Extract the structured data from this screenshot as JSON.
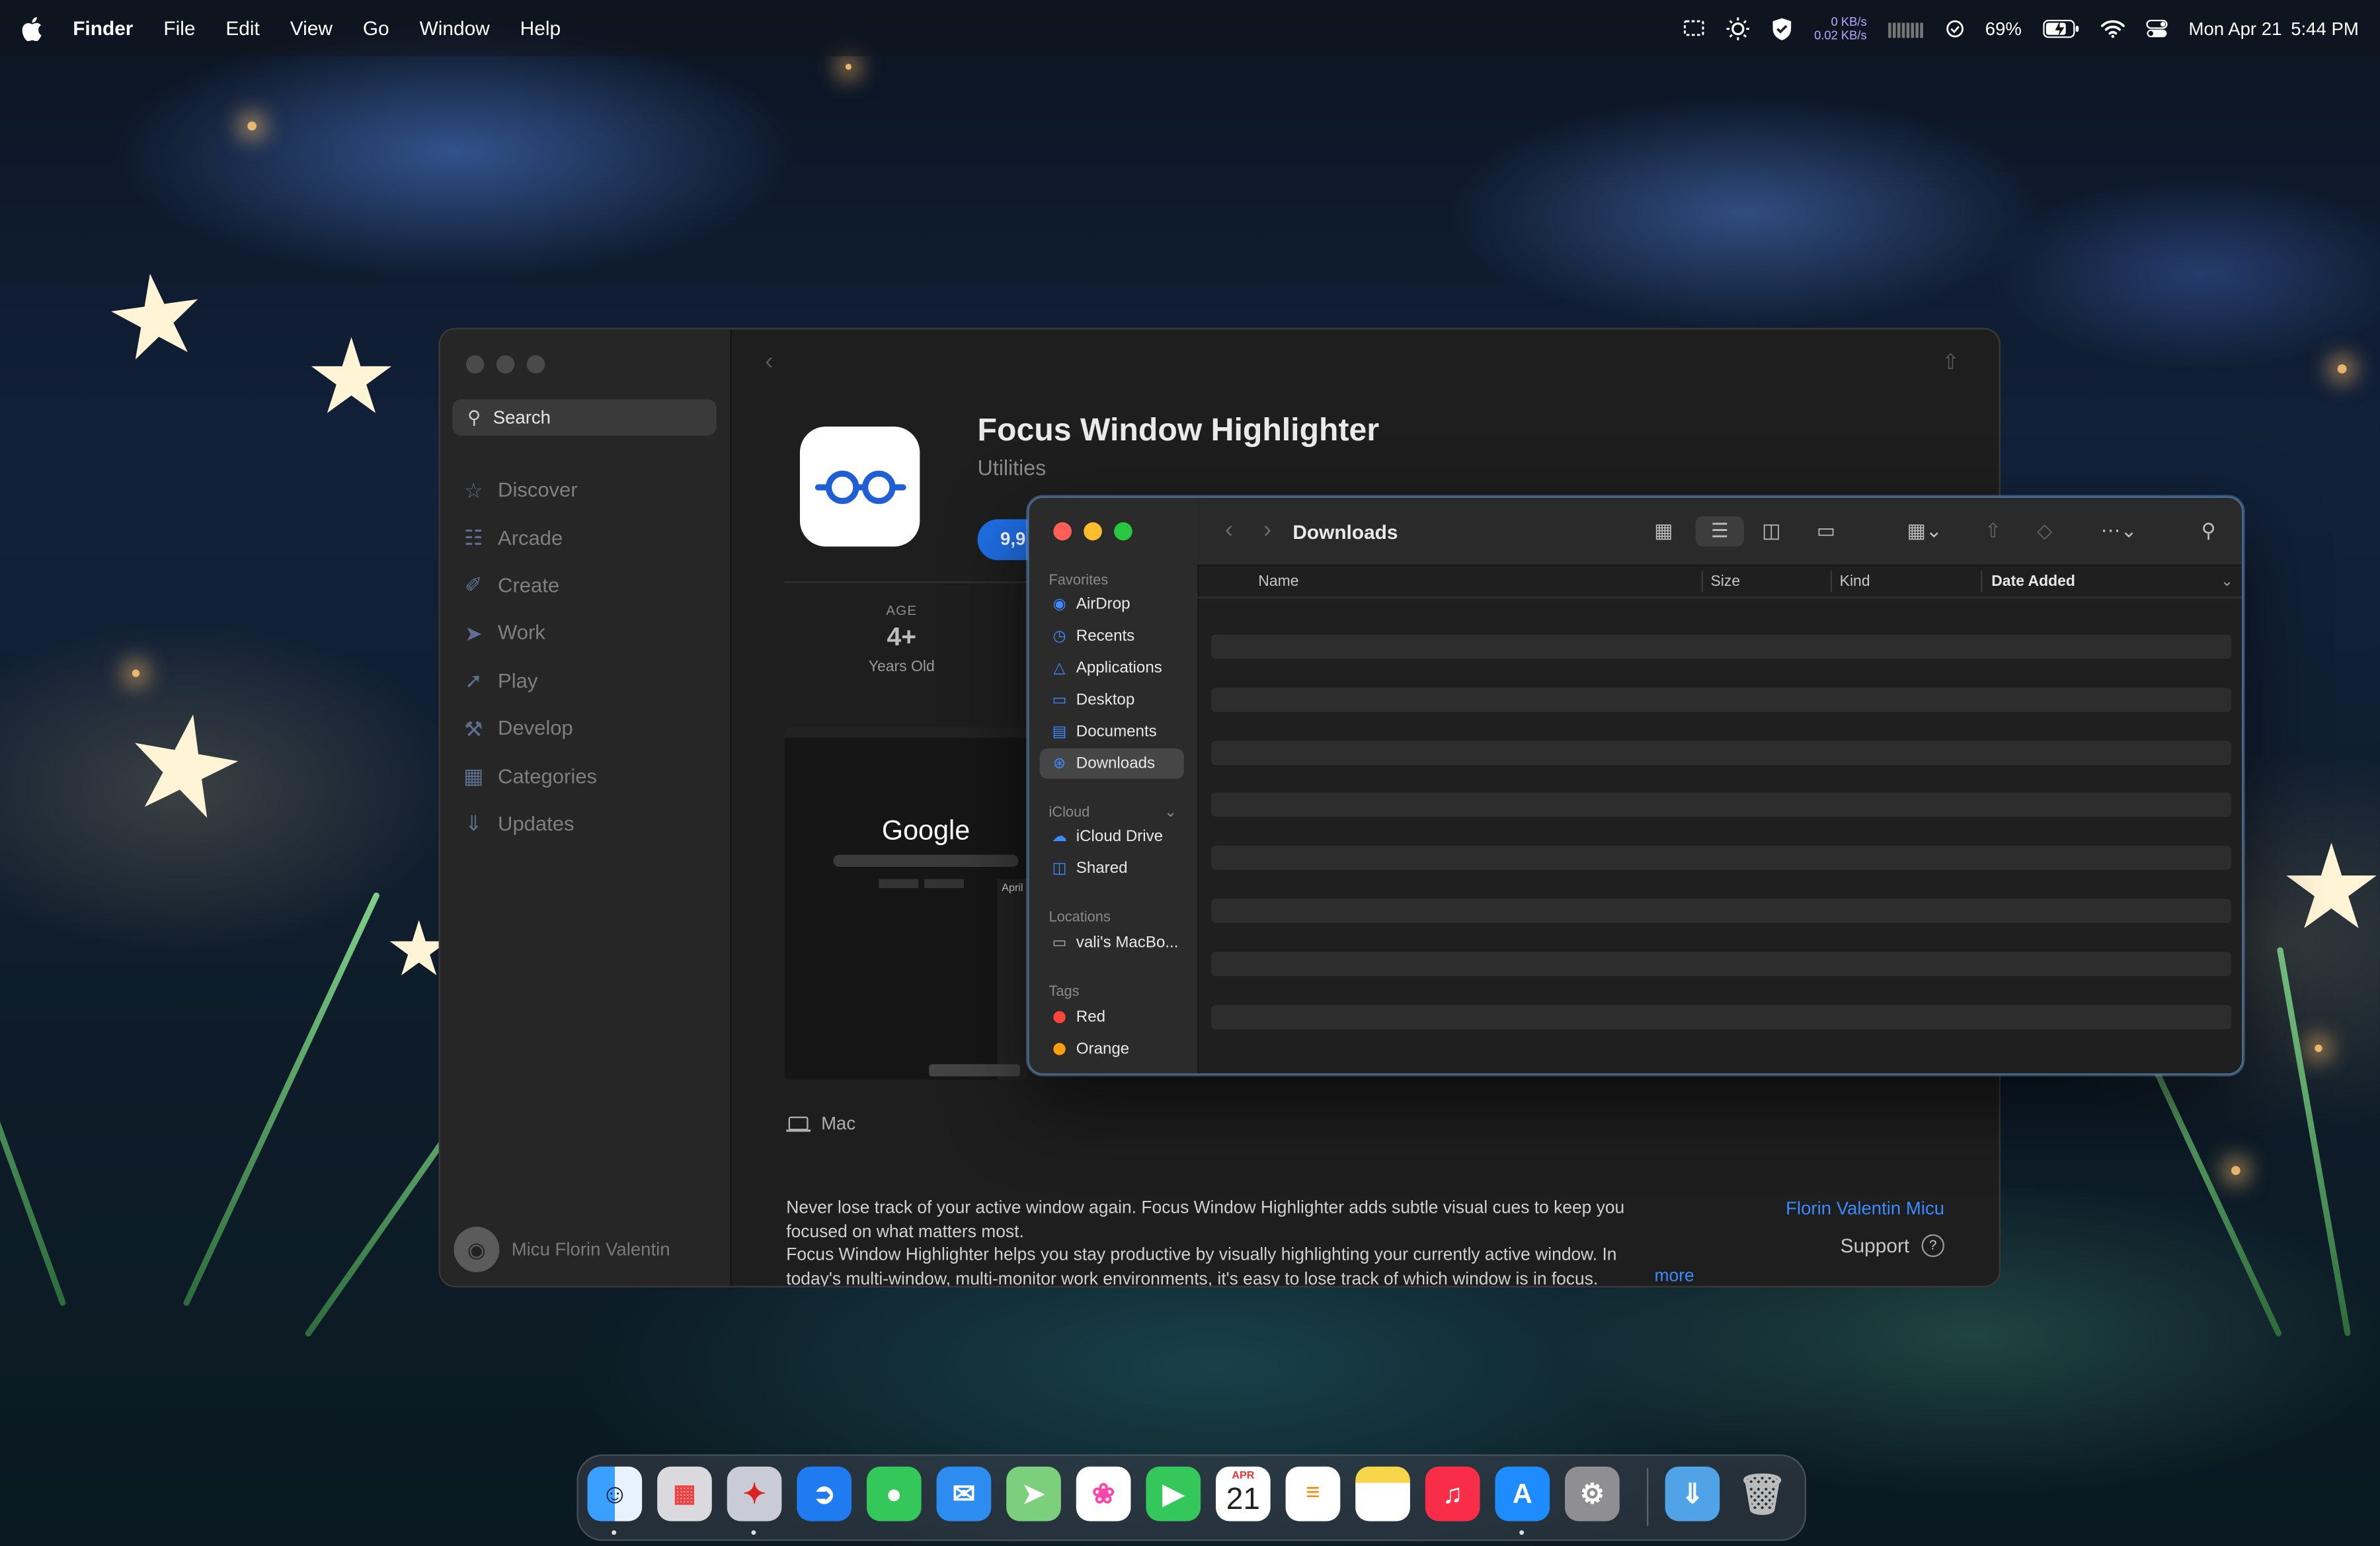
{
  "menubar": {
    "app": "Finder",
    "menus": [
      "File",
      "Edit",
      "View",
      "Go",
      "Window",
      "Help"
    ],
    "net_up": "0 KB/s",
    "net_down": "0.02 KB/s",
    "battery": "69%",
    "date": "Mon Apr 21",
    "time": "5:44 PM"
  },
  "appstore": {
    "search_placeholder": "Search",
    "nav": [
      "Discover",
      "Arcade",
      "Create",
      "Work",
      "Play",
      "Develop",
      "Categories",
      "Updates"
    ],
    "user": "Micu Florin Valentin",
    "app_title": "Focus Window Highlighter",
    "app_category": "Utilities",
    "price_partial": "9,9",
    "age_label": "AGE",
    "age_value": "4+",
    "age_sub": "Years Old",
    "screenshot_google": "Google",
    "screenshot_april": "April",
    "platform": "Mac",
    "description": "Never lose track of your active window again. Focus Window Highlighter adds subtle visual cues to keep you focused on what matters most.\nFocus Window Highlighter helps you stay productive by visually highlighting your currently active window. In today's multi-window, multi-monitor work environments, it's easy to lose track of which window is in focus.",
    "more": "more",
    "developer": "Florin Valentin Micu",
    "support": "Support"
  },
  "finder": {
    "title": "Downloads",
    "sections": {
      "favorites": "Favorites",
      "icloud": "iCloud",
      "locations": "Locations",
      "tags": "Tags"
    },
    "favorites": [
      "AirDrop",
      "Recents",
      "Applications",
      "Desktop",
      "Documents",
      "Downloads"
    ],
    "icloud_items": [
      "iCloud Drive",
      "Shared"
    ],
    "locations": [
      "vali's MacBo..."
    ],
    "tags": [
      {
        "name": "Red",
        "color": "#ff453a"
      },
      {
        "name": "Orange",
        "color": "#ff9f0a"
      }
    ],
    "columns": [
      "Name",
      "Size",
      "Kind",
      "Date Added"
    ],
    "selected_item": "Downloads"
  },
  "dock": {
    "calendar_month": "APR",
    "calendar_day": "21"
  }
}
